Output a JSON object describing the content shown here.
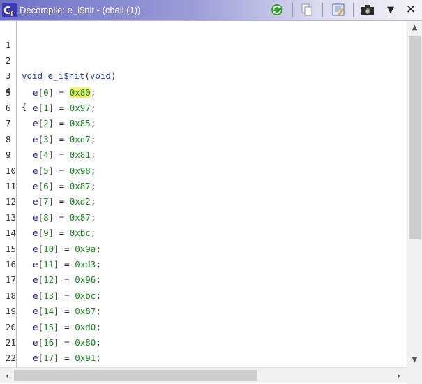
{
  "window": {
    "title": "Decompile: e_i$nit - (chall (1))"
  },
  "toolbar": {
    "buttons": [
      {
        "name": "refresh-icon"
      },
      {
        "name": "copy-icon"
      },
      {
        "name": "edit-icon"
      },
      {
        "name": "snapshot-icon"
      },
      {
        "name": "menu-dropdown-icon"
      },
      {
        "name": "close-icon"
      }
    ],
    "menu_glyph": "▼",
    "close_glyph": "✕"
  },
  "colors": {
    "keyword": "#2244aa",
    "number": "#12881a",
    "highlight": "#f4f470"
  },
  "code": {
    "line_numbers": [
      "1",
      "2",
      "3",
      "4",
      "5",
      "6",
      "7",
      "8",
      "9",
      "10",
      "11",
      "12",
      "13",
      "14",
      "15",
      "16",
      "17",
      "18",
      "19",
      "20",
      "21",
      "22"
    ],
    "signature": {
      "return_type": "void",
      "name": "e_i$nit",
      "open": "(",
      "param": "void",
      "close": ")"
    },
    "open_brace": "{",
    "assignments": [
      {
        "var": "e",
        "index": "0",
        "value": "0x80"
      },
      {
        "var": "e",
        "index": "1",
        "value": "0x97"
      },
      {
        "var": "e",
        "index": "2",
        "value": "0x85"
      },
      {
        "var": "e",
        "index": "3",
        "value": "0xd7"
      },
      {
        "var": "e",
        "index": "4",
        "value": "0x81"
      },
      {
        "var": "e",
        "index": "5",
        "value": "0x98"
      },
      {
        "var": "e",
        "index": "6",
        "value": "0x87"
      },
      {
        "var": "e",
        "index": "7",
        "value": "0xd2"
      },
      {
        "var": "e",
        "index": "8",
        "value": "0x87"
      },
      {
        "var": "e",
        "index": "9",
        "value": "0xbc"
      },
      {
        "var": "e",
        "index": "10",
        "value": "0x9a"
      },
      {
        "var": "e",
        "index": "11",
        "value": "0xd3"
      },
      {
        "var": "e",
        "index": "12",
        "value": "0x96"
      },
      {
        "var": "e",
        "index": "13",
        "value": "0xbc"
      },
      {
        "var": "e",
        "index": "14",
        "value": "0x87"
      },
      {
        "var": "e",
        "index": "15",
        "value": "0xd0"
      },
      {
        "var": "e",
        "index": "16",
        "value": "0x80"
      },
      {
        "var": "e",
        "index": "17",
        "value": "0x91"
      }
    ]
  },
  "scrollbars": {
    "up_arrow": "▲",
    "down_arrow": "▼",
    "left_arrow": "‹",
    "right_arrow": "›"
  }
}
